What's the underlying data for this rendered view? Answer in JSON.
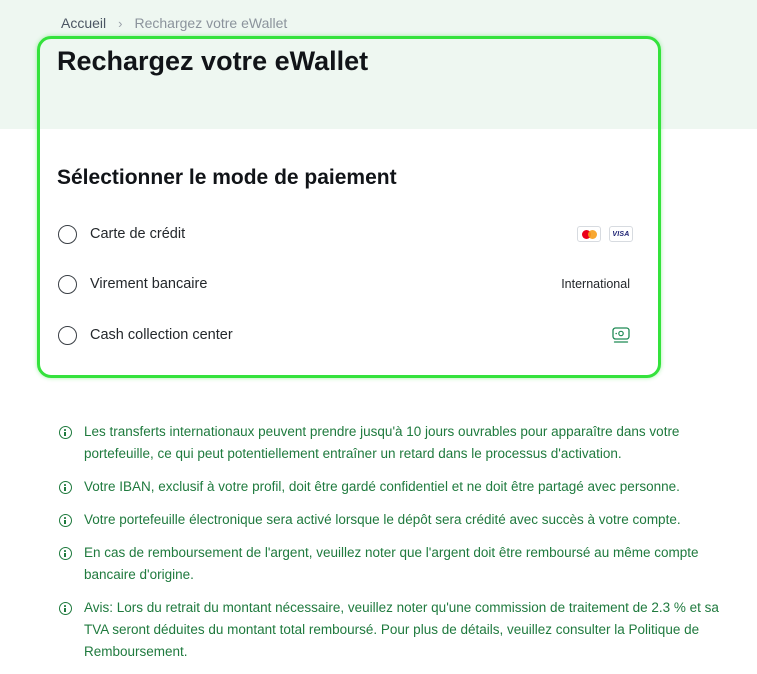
{
  "breadcrumb": {
    "home": "Accueil",
    "separator": "›",
    "current": "Rechargez votre eWallet"
  },
  "page": {
    "title": "Rechargez votre eWallet",
    "section_title": "Sélectionner le mode de paiement"
  },
  "payment_options": [
    {
      "label": "Carte de crédit",
      "badges": [
        "mastercard-icon",
        "VISA"
      ],
      "selected": false
    },
    {
      "label": "Virement bancaire",
      "right_text": "International",
      "selected": false
    },
    {
      "label": "Cash collection center",
      "icon": "cash-icon",
      "selected": false
    }
  ],
  "notes": [
    "Les transferts internationaux peuvent prendre jusqu'à 10 jours ouvrables pour apparaître dans votre portefeuille, ce qui peut potentiellement entraîner un retard dans le processus d'activation.",
    "Votre IBAN, exclusif à votre profil, doit être gardé confidentiel et ne doit être partagé avec personne.",
    "Votre portefeuille électronique sera activé lorsque le dépôt sera crédité avec succès à votre compte.",
    "En cas de remboursement de l'argent, veuillez noter que l'argent doit être remboursé au même compte bancaire d'origine.",
    "Avis: Lors du retrait du montant nécessaire, veuillez noter qu'une commission de traitement de 2.3 % et sa TVA seront déduites du montant total remboursé. Pour plus de détails, veuillez consulter la Politique de Remboursement."
  ],
  "colors": {
    "hero_bg": "#eef7f1",
    "highlight_border": "#34e23c",
    "note_text": "#1f7a3e"
  }
}
